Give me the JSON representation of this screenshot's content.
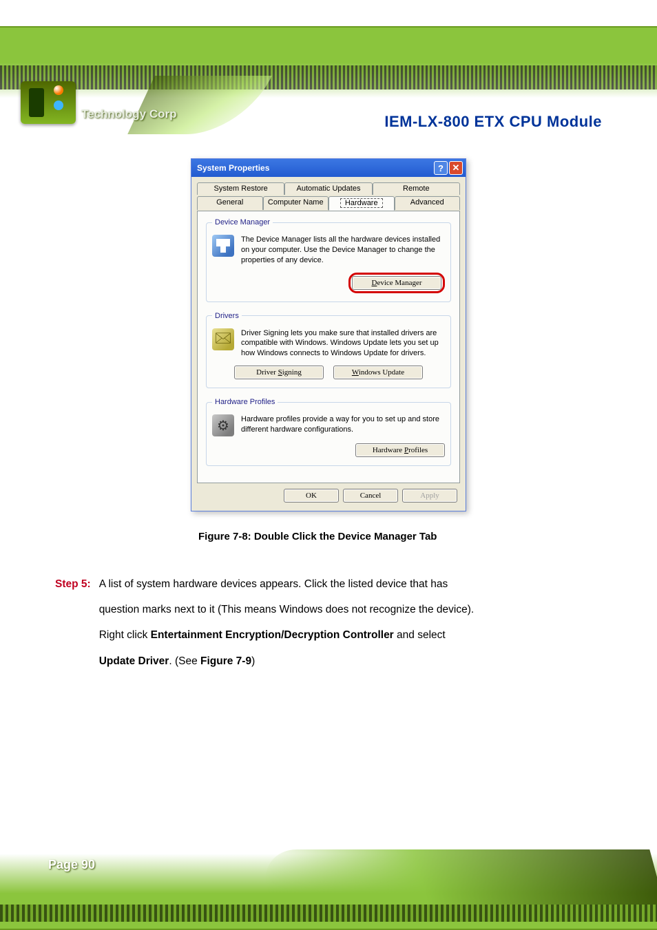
{
  "header": {
    "brand": "Technology Corp",
    "doc_title": "IEM-LX-800  ETX  CPU  Module"
  },
  "dialog": {
    "title": "System Properties",
    "tabs_back": [
      "System Restore",
      "Automatic Updates",
      "Remote"
    ],
    "tabs_front": [
      "General",
      "Computer Name",
      "Hardware",
      "Advanced"
    ],
    "active_tab": "Hardware",
    "sections": {
      "device_manager": {
        "legend": "Device Manager",
        "text": "The Device Manager lists all the hardware devices installed on your computer. Use the Device Manager to change the properties of any device.",
        "button": "Device Manager"
      },
      "drivers": {
        "legend": "Drivers",
        "text": "Driver Signing lets you make sure that installed drivers are compatible with Windows. Windows Update lets you set up how Windows connects to Windows Update for drivers.",
        "btn1": "Driver Signing",
        "btn2": "Windows Update"
      },
      "hw_profiles": {
        "legend": "Hardware Profiles",
        "text": "Hardware profiles provide a way for you to set up and store different hardware configurations.",
        "button": "Hardware Profiles"
      }
    },
    "footer": {
      "ok": "OK",
      "cancel": "Cancel",
      "apply": "Apply"
    }
  },
  "figure_caption": "Figure 7-8: Double Click the Device Manager Tab",
  "step": {
    "label": "Step 5:",
    "line1": "A list of system hardware devices appears. Click the listed device that has",
    "line2": "question marks next to it (This means Windows does not recognize the device).",
    "line3a": "Right click ",
    "line3b": "Entertainment Encryption/Decryption Controller",
    "line3c": " and select",
    "line4a": "Update Driver",
    "line4b": ". (See ",
    "line4c": "Figure 7-9",
    "line4d": ")"
  },
  "footer": {
    "page": "Page 90"
  }
}
